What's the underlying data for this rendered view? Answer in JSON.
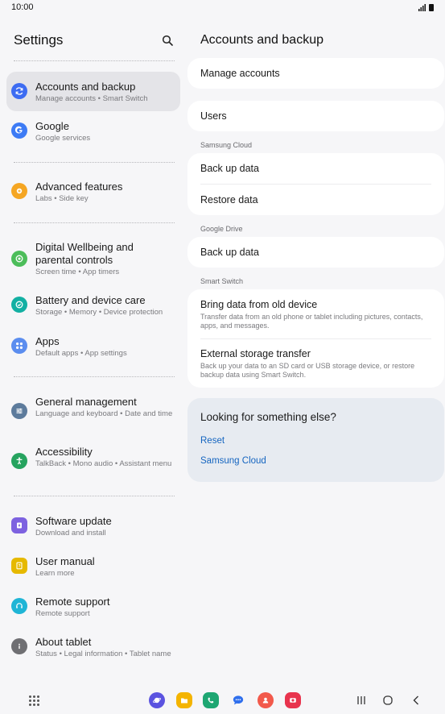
{
  "status_bar": {
    "time": "10:00"
  },
  "left_pane": {
    "title": "Settings",
    "items": [
      {
        "label": "Accounts and backup",
        "sub": "Manage accounts  •  Smart Switch",
        "icon": "sync-icon",
        "color": "#3d6cf2",
        "active": true
      },
      {
        "label": "Google",
        "sub": "Google services",
        "icon": "google-icon",
        "color": "#3d7bf5"
      },
      {
        "label": "Advanced features",
        "sub": "Labs  •  Side key",
        "icon": "gear-plus-icon",
        "color": "#f5a623"
      },
      {
        "label": "Digital Wellbeing and parental controls",
        "sub": "Screen time  •  App timers",
        "icon": "wellbeing-icon",
        "color": "#4cbd5a"
      },
      {
        "label": "Battery and device care",
        "sub": "Storage  •  Memory  •  Device protection",
        "icon": "device-care-icon",
        "color": "#13b0a3"
      },
      {
        "label": "Apps",
        "sub": "Default apps  •  App settings",
        "icon": "apps-icon",
        "color": "#5b8def"
      },
      {
        "label": "General management",
        "sub": "Language and keyboard  •  Date and time",
        "icon": "sliders-icon",
        "color": "#5d7b9c"
      },
      {
        "label": "Accessibility",
        "sub": "TalkBack  •  Mono audio  •  Assistant menu",
        "icon": "accessibility-icon",
        "color": "#26a35f"
      },
      {
        "label": "Software update",
        "sub": "Download and install",
        "icon": "software-update-icon",
        "color": "#7d62e0"
      },
      {
        "label": "User manual",
        "sub": "Learn more",
        "icon": "manual-icon",
        "color": "#e6b900"
      },
      {
        "label": "Remote support",
        "sub": "Remote support",
        "icon": "headset-icon",
        "color": "#1fb5d6"
      },
      {
        "label": "About tablet",
        "sub": "Status  •  Legal information  •  Tablet name",
        "icon": "info-icon",
        "color": "#6f6f73"
      }
    ]
  },
  "right_pane": {
    "title": "Accounts and backup",
    "manage_accounts": "Manage accounts",
    "users": "Users",
    "samsung_cloud_label": "Samsung Cloud",
    "sc_backup": "Back up data",
    "sc_restore": "Restore data",
    "google_drive_label": "Google Drive",
    "gd_backup": "Back up data",
    "smart_switch_label": "Smart Switch",
    "bring_data": "Bring data from old device",
    "bring_data_desc": "Transfer data from an old phone or tablet including pictures, contacts, apps, and messages.",
    "external_transfer": "External storage transfer",
    "external_transfer_desc": "Back up your data to an SD card or USB storage device, or restore backup data using Smart Switch.",
    "info_title": "Looking for something else?",
    "link_reset": "Reset",
    "link_samsung_cloud": "Samsung Cloud"
  },
  "colors": {
    "accent_link": "#1565c0",
    "active_item": "#e4e4e8"
  }
}
